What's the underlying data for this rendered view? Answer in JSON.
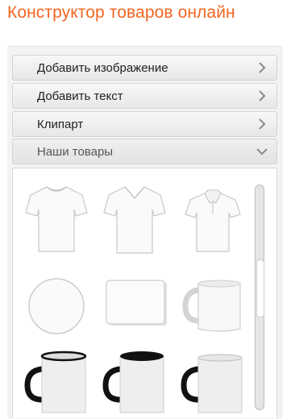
{
  "page_title": "Конструктор товаров онлайн",
  "accordion": [
    {
      "label": "Добавить изображение",
      "icon": "chevron-right-icon",
      "open": false
    },
    {
      "label": "Добавить текст",
      "icon": "chevron-right-icon",
      "open": false
    },
    {
      "label": "Клипарт",
      "icon": "chevron-right-icon",
      "open": false
    },
    {
      "label": "Наши товары",
      "icon": "chevron-down-icon",
      "open": true
    }
  ],
  "products": [
    {
      "name": "tshirt-crewneck"
    },
    {
      "name": "tshirt-vneck"
    },
    {
      "name": "polo-shirt"
    },
    {
      "name": "round-coaster"
    },
    {
      "name": "mouse-pad"
    },
    {
      "name": "white-mug"
    },
    {
      "name": "mug-black-rim-handle"
    },
    {
      "name": "mug-black-inside"
    },
    {
      "name": "mug-black-handle"
    }
  ],
  "colors": {
    "title": "#f26522",
    "panel_bg": "#f3f3f3",
    "accent_black": "#111111"
  }
}
